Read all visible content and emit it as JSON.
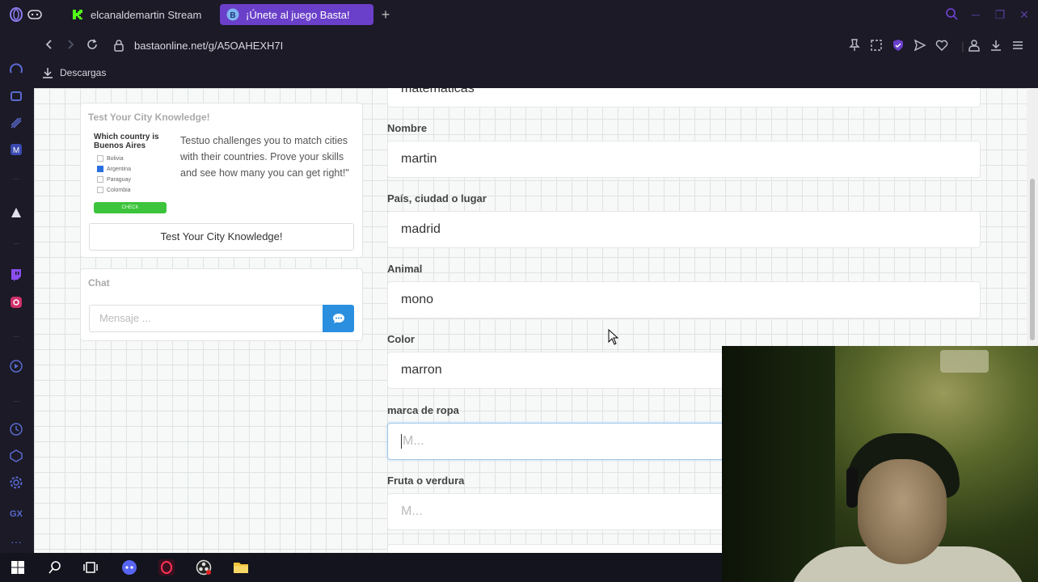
{
  "browser": {
    "tabs": [
      {
        "label": "elcanaldemartin Stream",
        "icon": "kick-icon",
        "active": false
      },
      {
        "label": "¡Únete al juego Basta!",
        "icon": "basta-icon",
        "active": true
      }
    ],
    "url": "bastaonline.net/g/A5OAHEXH7I",
    "bookmarks": [
      {
        "label": "Descargas",
        "icon": "download-icon"
      }
    ]
  },
  "promo": {
    "title": "Test Your City Knowledge!",
    "image": {
      "question": "Which country is Buenos Aires",
      "options": [
        "Bolivia",
        "Argentina",
        "Paraguay",
        "Colombia"
      ],
      "checked_option": "Argentina",
      "check_label": "CHECK"
    },
    "description": "Testuo challenges you to match cities with their countries. Prove your skills and see how many you can get right!\"",
    "button_label": "Test Your City Knowledge!"
  },
  "chat": {
    "title": "Chat",
    "input_placeholder": "Mensaje ...",
    "send_icon": "chat-bubble-icon"
  },
  "form": {
    "top_partial_value": "matematicas",
    "fields": [
      {
        "label": "Nombre",
        "value": "martin"
      },
      {
        "label": "País, ciudad o lugar",
        "value": "madrid"
      },
      {
        "label": "Animal",
        "value": "mono"
      },
      {
        "label": "Color",
        "value": "marron"
      },
      {
        "label": "marca de ropa",
        "value": "",
        "placeholder": "M...",
        "focused": true
      },
      {
        "label": "Fruta o verdura",
        "value": "",
        "placeholder": "M..."
      }
    ]
  },
  "colors": {
    "browser_bg": "#1b1a26",
    "active_tab": "#6a3fc9",
    "send_button": "#2b8fe0",
    "check_button": "#3cc43c"
  }
}
